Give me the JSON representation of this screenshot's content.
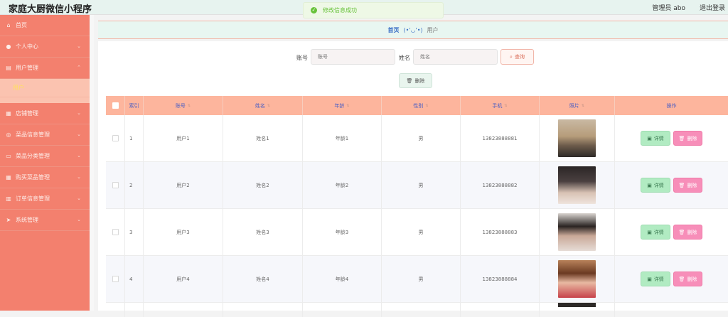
{
  "header": {
    "brand": "家庭大厨微信小程序",
    "user_info": "管理员 abo",
    "logout": "退出登录"
  },
  "toast": {
    "message": "修改信息成功"
  },
  "sidebar": {
    "items": [
      {
        "label": "首页",
        "icon": "home-icon",
        "chevron": false
      },
      {
        "label": "个人中心",
        "icon": "person-icon",
        "chevron": true
      },
      {
        "label": "用户管理",
        "icon": "doc-icon",
        "chevron": true,
        "active": true
      },
      {
        "label": "店铺管理",
        "icon": "shop-icon",
        "chevron": true
      },
      {
        "label": "菜品信息管理",
        "icon": "dish-icon",
        "chevron": true
      },
      {
        "label": "菜品分类管理",
        "icon": "monitor-icon",
        "chevron": true
      },
      {
        "label": "购买菜品管理",
        "icon": "grid-icon",
        "chevron": true
      },
      {
        "label": "订单信息管理",
        "icon": "chart-icon",
        "chevron": true
      },
      {
        "label": "系统管理",
        "icon": "send-icon",
        "chevron": true
      }
    ],
    "submenu": {
      "label": "用户"
    }
  },
  "breadcrumb": {
    "home": "首页",
    "sep": "(•'◡'•)",
    "current": "用户"
  },
  "search": {
    "account_label": "账号",
    "account_placeholder": "账号",
    "name_label": "姓名",
    "name_placeholder": "姓名",
    "query_button": "查询"
  },
  "toolbar": {
    "delete_label": "删除"
  },
  "table": {
    "headers": {
      "index": "索引",
      "account": "账号",
      "name": "姓名",
      "age": "年龄",
      "gender": "性别",
      "phone": "手机",
      "photo": "照片",
      "action": "操作"
    },
    "detail_label": "详情",
    "delete_label": "删除",
    "rows": [
      {
        "index": "1",
        "account": "用户1",
        "name": "姓名1",
        "age": "年龄1",
        "gender": "男",
        "phone": "13823888881"
      },
      {
        "index": "2",
        "account": "用户2",
        "name": "姓名2",
        "age": "年龄2",
        "gender": "男",
        "phone": "13823888882"
      },
      {
        "index": "3",
        "account": "用户3",
        "name": "姓名3",
        "age": "年龄3",
        "gender": "男",
        "phone": "13823888883"
      },
      {
        "index": "4",
        "account": "用户4",
        "name": "姓名4",
        "age": "年龄4",
        "gender": "男",
        "phone": "13823888884"
      }
    ]
  },
  "colors": {
    "sidebar": "#f3806e",
    "table_header": "#fdb59d",
    "header_text": "#4a5ec4",
    "detail_btn": "#b1ebc2",
    "delete_btn": "#f78eb9"
  }
}
